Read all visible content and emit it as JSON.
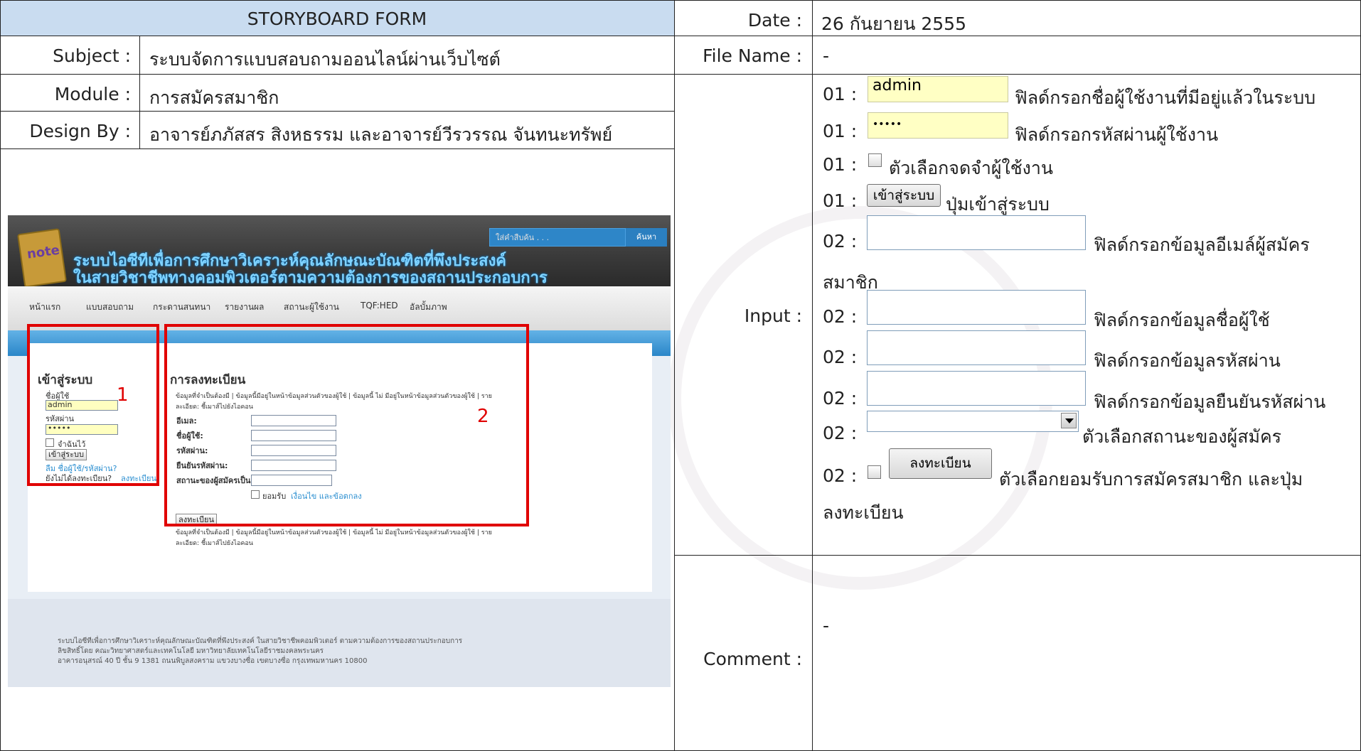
{
  "header": {
    "form_title": "STORYBOARD FORM",
    "date_label": "Date :",
    "date_value": "26 กันยายน 2555"
  },
  "rows": {
    "subject_label": "Subject :",
    "subject_value": "ระบบจัดการแบบสอบถามออนไลน์ผ่านเว็บไซต์",
    "filename_label": "File Name :",
    "filename_value": "-",
    "module_label": "Module :",
    "module_value": "การสมัครสมาชิก",
    "design_label": "Design By :",
    "design_value": "อาจารย์ภภัสสร สิงหธรรม และอาจารย์วีรวรรณ จันทนะทรัพย์"
  },
  "input": {
    "label": "Input :",
    "items": [
      {
        "num": "01 :",
        "field_value": "admin",
        "desc": "ฟิลด์กรอกชื่อผู้ใช้งานที่มีอยู่แล้วในระบบ"
      },
      {
        "num": "01 :",
        "field_value": "•••••",
        "desc": "ฟิลด์กรอกรหัสผ่านผู้ใช้งาน"
      },
      {
        "num": "01 :",
        "desc": "ตัวเลือกจดจำผู้ใช้งาน"
      },
      {
        "num": "01 :",
        "button": "เข้าสู่ระบบ",
        "desc": "ปุ่มเข้าสู่ระบบ"
      },
      {
        "num": "02 :",
        "desc": "ฟิลด์กรอกข้อมูลอีเมล์ผู้สมัคร"
      },
      {
        "num": "",
        "desc": "สมาชิก"
      },
      {
        "num": "02 :",
        "desc": "ฟิลด์กรอกข้อมูลชื่อผู้ใช้"
      },
      {
        "num": "02 :",
        "desc": "ฟิลด์กรอกข้อมูลรหัสผ่าน"
      },
      {
        "num": "02 :",
        "desc": "ฟิลด์กรอกข้อมูลยืนยันรหัสผ่าน"
      },
      {
        "num": "02 :",
        "desc": "ตัวเลือกสถานะของผู้สมัคร"
      },
      {
        "num": "02 :",
        "button": "ลงทะเบียน",
        "desc": "ตัวเลือกยอมรับการสมัครสมาชิก และปุ่ม"
      },
      {
        "num": "",
        "desc": "ลงทะเบียน"
      }
    ]
  },
  "comment": {
    "label": "Comment :",
    "value": "-"
  },
  "screenshot": {
    "site_title_line1": "ระบบไอซีทีเพื่อการศึกษาวิเคราะห์คุณลักษณะบัณฑิตที่พึงประสงค์",
    "site_title_line2": "ในสายวิชาชีพทางคอมพิวเตอร์ตามความต้องการของสถานประกอบการ",
    "search_placeholder": "ใส่คำสืบค้น . . .",
    "search_button": "ค้นหา",
    "nav": [
      "หน้าแรก",
      "แบบสอบถาม",
      "กระดานสนทนา",
      "รายงานผล",
      "สถานะผู้ใช้งาน",
      "TQF:HED",
      "อัลบั้มภาพ"
    ],
    "login": {
      "title": "เข้าสู่ระบบ",
      "user_label": "ชื่อผู้ใช้",
      "user_value": "admin",
      "pass_label": "รหัสผ่าน",
      "pass_value": "•••••",
      "remember": "จำฉันไว้",
      "button": "เข้าสู่ระบบ",
      "forgot": "ลืม ชื่อผู้ใช้/รหัสผ่าน?",
      "not_registered": "ยังไม่ได้ลงทะเบียน?",
      "register_link": "ลงทะเบียน",
      "box_number": "1"
    },
    "register": {
      "title": "การลงทะเบียน",
      "legend_line1": "ข้อมูลที่จำเป็นต้องมี | ข้อมูลนี้มีอยู่ในหน้าข้อมูลส่วนตัวของผู้ใช้ | ข้อมูลนี้ ไม่ มีอยู่ในหน้าข้อมูลส่วนตัวของผู้ใช้ | ราย",
      "legend_line2": "ละเอียด: ชี้เมาส์ไปยังไอคอน",
      "email_label": "อีเมล:",
      "username_label": "ชื่อผู้ใช้:",
      "password_label": "รหัสผ่าน:",
      "confirm_label": "ยืนยันรหัสผ่าน:",
      "status_label": "สถานะของผู้สมัครเป็น:",
      "accept_text": "ยอมรับ",
      "accept_link": "เงื่อนไข และข้อตกลง",
      "button": "ลงทะเบียน",
      "box_number": "2"
    },
    "footer_line1": "ระบบไอซีทีเพื่อการศึกษาวิเคราะห์คุณลักษณะบัณฑิตที่พึงประสงค์ ในสายวิชาชีพคอมพิวเตอร์ ตามความต้องการของสถานประกอบการ",
    "footer_line2": "ลิขสิทธิ์โดย คณะวิทยาศาสตร์และเทคโนโลยี มหาวิทยาลัยเทคโนโลยีราชมงคลพระนคร",
    "footer_line3": "อาคารอนุสรณ์ 40 ปี ชั้น 9 1381 ถนนพิบูลสงคราม แขวงบางซื่อ เขตบางซื่อ กรุงเทพมหานคร 10800"
  },
  "colors": {
    "header_bg": "#c9dcf0",
    "red_box": "#e00000",
    "field_yellow": "#ffffc4"
  }
}
